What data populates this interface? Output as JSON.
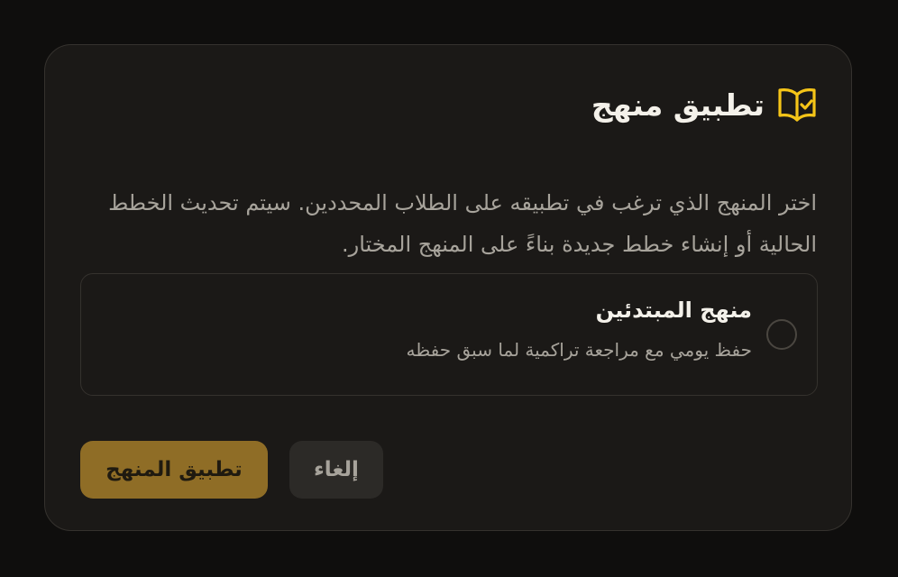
{
  "dialog": {
    "title": "تطبيق منهج",
    "title_icon": "book-check-icon",
    "description": "اختر المنهج الذي ترغب في تطبيقه على الطلاب المحددين. سيتم تحديث الخطط الحالية أو إنشاء خطط جديدة بناءً على المنهج المختار.",
    "options": [
      {
        "name": "منهج المبتدئين",
        "description": "حفظ يومي مع مراجعة تراكمية لما سبق حفظه",
        "selected": false
      }
    ],
    "buttons": {
      "apply": "تطبيق المنهج",
      "cancel": "إلغاء"
    }
  },
  "colors": {
    "accent": "#f5c518",
    "apply_button": "#8f6d26",
    "background": "#0f0e0d",
    "dialog": "#1b1917"
  }
}
